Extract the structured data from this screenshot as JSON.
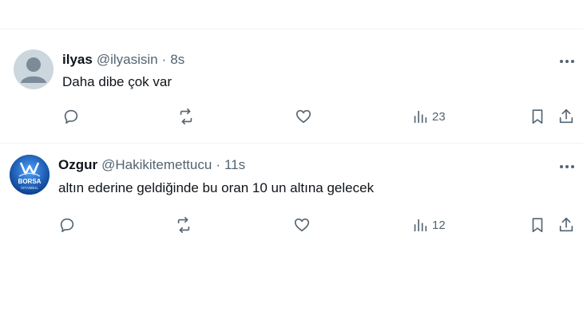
{
  "tweets": [
    {
      "display_name": "ilyas",
      "handle": "@ilyasisin",
      "separator": "·",
      "time": "8s",
      "text": "Daha dibe çok var",
      "views": "23",
      "avatar": "default-avatar"
    },
    {
      "display_name": "Ozgur",
      "handle": "@Hakikitemettucu",
      "separator": "·",
      "time": "11s",
      "text": "altın ederine geldiğinde bu oran 10 un altına gelecek",
      "views": "12",
      "avatar": "borsa-istanbul-logo",
      "avatar_text": "BORSA",
      "avatar_subtext": "İSTANBUL"
    }
  ],
  "icons": [
    "more-icon",
    "reply-icon",
    "retweet-icon",
    "like-icon",
    "views-icon",
    "bookmark-icon",
    "share-icon"
  ],
  "colors": {
    "text": "#0f1419",
    "muted": "#536471",
    "divider": "#eff3f4",
    "avatar_default": "#ccd6dd",
    "borsa_blue": "#1565c0"
  }
}
